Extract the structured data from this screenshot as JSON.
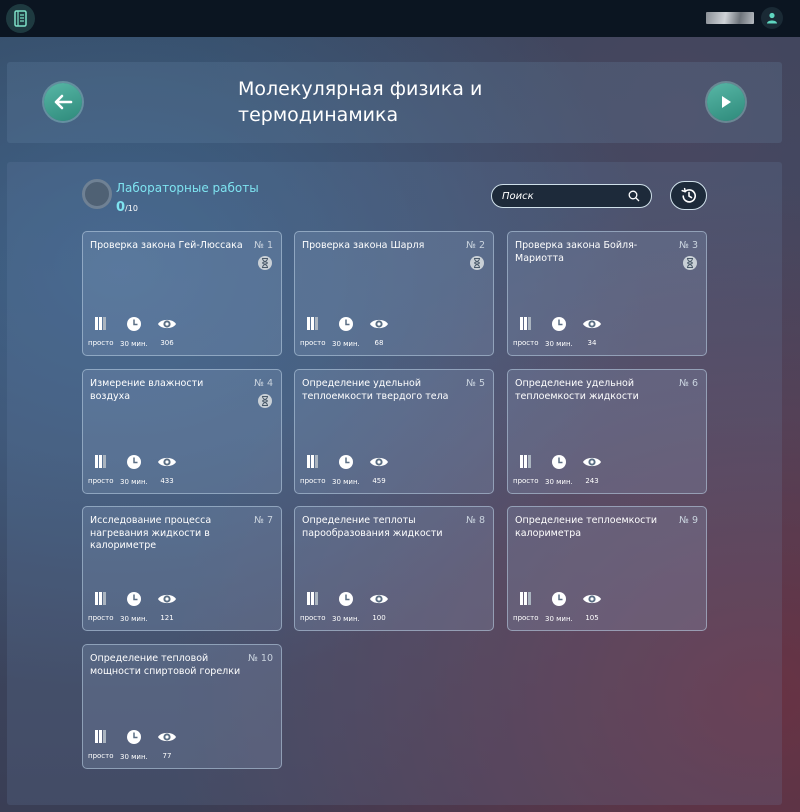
{
  "header": {
    "title": "Молекулярная физика и термодинамика"
  },
  "labs": {
    "title": "Лабораторные работы",
    "done": "0",
    "total": "/10"
  },
  "search": {
    "placeholder": "Поиск"
  },
  "colors": {
    "accent": "#7ee3f0",
    "button": "#3fa190",
    "topbar": "#0b1521"
  },
  "cards": [
    {
      "title": "Проверка закона Гей-Люссака",
      "num": "№ 1",
      "difficulty": "просто",
      "time": "30 мин.",
      "views": "306",
      "pending": true
    },
    {
      "title": "Проверка закона Шарля",
      "num": "№ 2",
      "difficulty": "просто",
      "time": "30 мин.",
      "views": "68",
      "pending": true
    },
    {
      "title": "Проверка закона Бойля-Мариотта",
      "num": "№ 3",
      "difficulty": "просто",
      "time": "30 мин.",
      "views": "34",
      "pending": true
    },
    {
      "title": "Измерение влажности воздуха",
      "num": "№ 4",
      "difficulty": "просто",
      "time": "30 мин.",
      "views": "433",
      "pending": true
    },
    {
      "title": "Определение удельной теплоемкости твердого тела",
      "num": "№ 5",
      "difficulty": "просто",
      "time": "30 мин.",
      "views": "459",
      "pending": false
    },
    {
      "title": "Определение удельной теплоемкости жидкости",
      "num": "№ 6",
      "difficulty": "просто",
      "time": "30 мин.",
      "views": "243",
      "pending": false
    },
    {
      "title": "Исследование процесса нагревания жидкости в калориметре",
      "num": "№ 7",
      "difficulty": "просто",
      "time": "30 мин.",
      "views": "121",
      "pending": false
    },
    {
      "title": "Определение теплоты парообразования жидкости",
      "num": "№ 8",
      "difficulty": "просто",
      "time": "30 мин.",
      "views": "100",
      "pending": false
    },
    {
      "title": "Определение теплоемкости калориметра",
      "num": "№ 9",
      "difficulty": "просто",
      "time": "30 мин.",
      "views": "105",
      "pending": false
    },
    {
      "title": "Определение тепловой мощности спиртовой горелки",
      "num": "№ 10",
      "difficulty": "просто",
      "time": "30 мин.",
      "views": "77",
      "pending": false
    }
  ]
}
